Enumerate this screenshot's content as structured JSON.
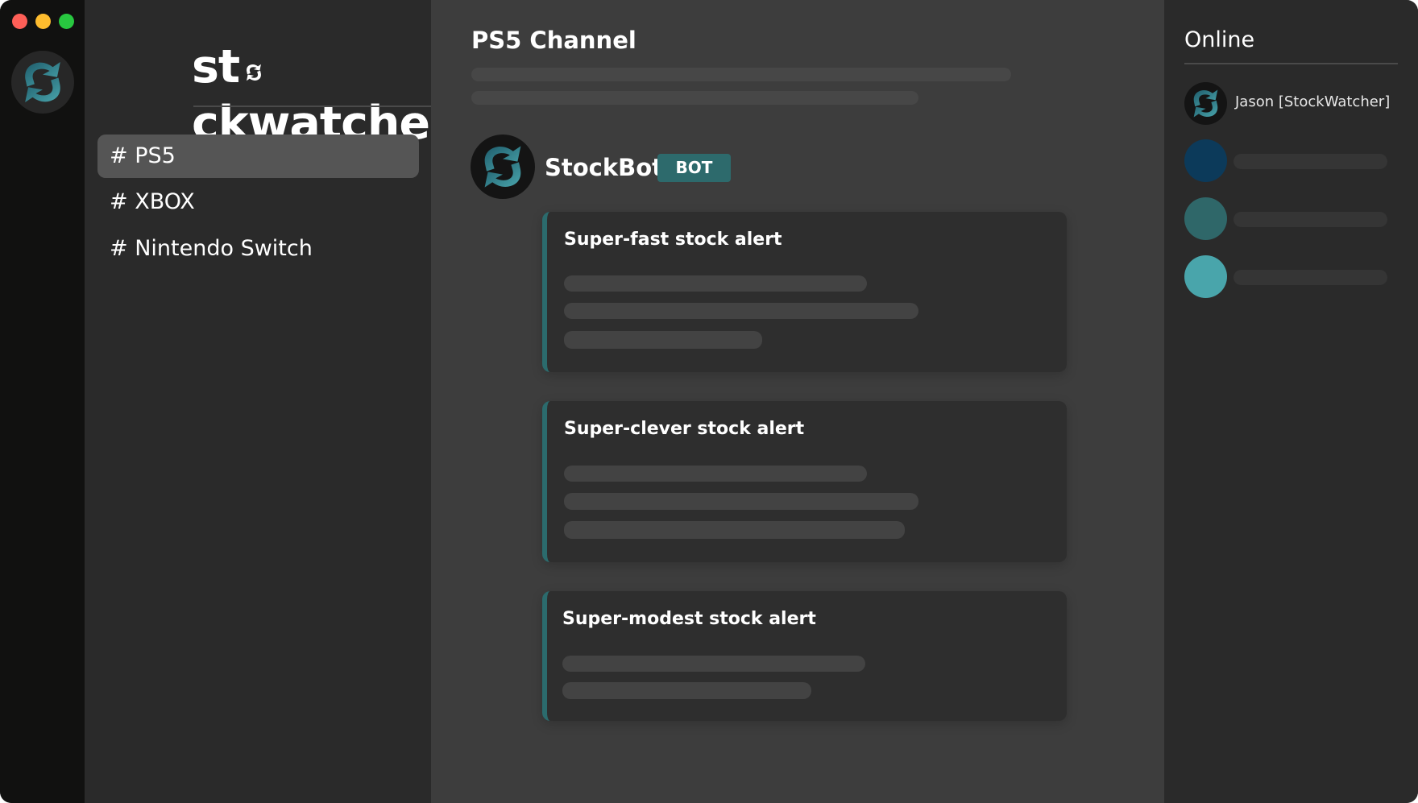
{
  "window": {
    "traffic_lights": [
      "close",
      "minimize",
      "maximize"
    ]
  },
  "brand": {
    "wordmark_before": "st",
    "wordmark_o": "o",
    "wordmark_after": "ckwatcher",
    "logo_icon": "refresh-arrows-icon",
    "accent_color": "#2d6a6c"
  },
  "sidebar": {
    "channels": [
      {
        "label": "# PS5",
        "active": true
      },
      {
        "label": "# XBOX",
        "active": false
      },
      {
        "label": "# Nintendo Switch",
        "active": false
      }
    ]
  },
  "main": {
    "title": "PS5 Channel",
    "message": {
      "author": "StockBot",
      "badge": "BOT",
      "cards": [
        {
          "title": "Super-fast stock alert"
        },
        {
          "title": "Super-clever stock alert"
        },
        {
          "title": "Super-modest stock alert"
        }
      ]
    }
  },
  "members": {
    "title": "Online",
    "list": [
      {
        "name": "Jason [StockWatcher]",
        "avatar": "refresh-arrows-icon"
      },
      {
        "name": null,
        "avatar_color": "#0c3a5a"
      },
      {
        "name": null,
        "avatar_color": "#2f6769"
      },
      {
        "name": null,
        "avatar_color": "#49a5ab"
      }
    ]
  }
}
